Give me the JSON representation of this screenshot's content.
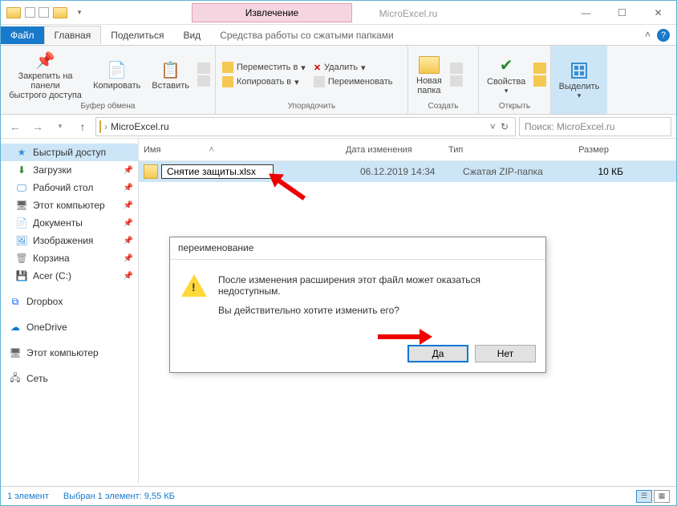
{
  "titlebar": {
    "extract_label": "Извлечение",
    "app_title": "MicroExcel.ru"
  },
  "win": {
    "min": "—",
    "max": "☐",
    "close": "✕"
  },
  "tabs": {
    "file": "Файл",
    "home": "Главная",
    "share": "Поделиться",
    "view": "Вид",
    "tool": "Средства работы со сжатыми папками"
  },
  "ribbon": {
    "pin": "Закрепить на панели\nбыстрого доступа",
    "copy": "Копировать",
    "paste": "Вставить",
    "clipboard_label": "Буфер обмена",
    "move_to": "Переместить в",
    "copy_to": "Копировать в",
    "delete": "Удалить",
    "rename": "Переименовать",
    "organize_label": "Упорядочить",
    "new_folder": "Новая\nпапка",
    "create_label": "Создать",
    "properties": "Свойства",
    "open_label": "Открыть",
    "select": "Выделить",
    "dd": "▾"
  },
  "address": {
    "root": "MicroExcel.ru",
    "search_placeholder": "Поиск: MicroExcel.ru"
  },
  "columns": {
    "name": "Имя",
    "date": "Дата изменения",
    "type": "Тип",
    "size": "Размер"
  },
  "file": {
    "name": "Снятие защиты.xlsx",
    "date": "06.12.2019 14:34",
    "type": "Сжатая ZIP-папка",
    "size": "10 КБ"
  },
  "sidebar": {
    "quick": "Быстрый доступ",
    "downloads": "Загрузки",
    "desktop": "Рабочий стол",
    "thispc_short": "Этот компьютер",
    "documents": "Документы",
    "pictures": "Изображения",
    "recycle": "Корзина",
    "drive": "Acer (C:)",
    "dropbox": "Dropbox",
    "onedrive": "OneDrive",
    "thispc": "Этот компьютер",
    "network": "Сеть"
  },
  "dialog": {
    "title": "переименование",
    "line1": "После изменения расширения этот файл может оказаться недоступным.",
    "line2": "Вы действительно хотите изменить его?",
    "yes": "Да",
    "no": "Нет"
  },
  "status": {
    "count": "1 элемент",
    "selected": "Выбран 1 элемент: 9,55 КБ"
  }
}
